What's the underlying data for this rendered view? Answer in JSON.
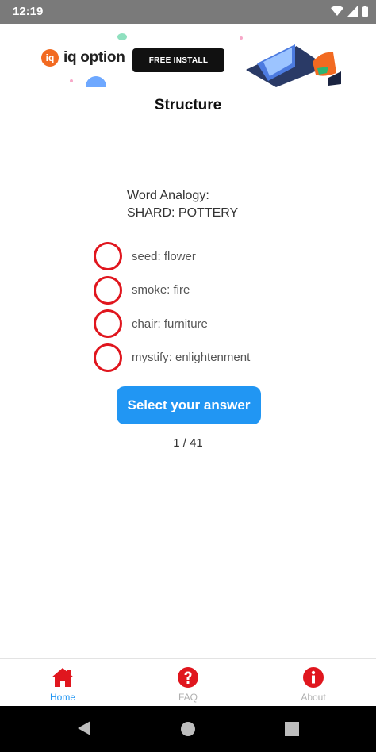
{
  "status_bar": {
    "time": "12:19"
  },
  "ad": {
    "brand": "iq option",
    "cta": "FREE INSTALL"
  },
  "page": {
    "title": "Structure"
  },
  "question": {
    "prompt": "Word Analogy:",
    "pair": "SHARD: POTTERY"
  },
  "options": [
    {
      "label": "seed: flower"
    },
    {
      "label": "smoke: fire"
    },
    {
      "label": "chair: furniture"
    },
    {
      "label": "mystify: enlightenment"
    }
  ],
  "submit": {
    "label": "Select your answer"
  },
  "progress": {
    "text": "1 / 41"
  },
  "bottom_nav": {
    "items": [
      {
        "label": "Home",
        "icon": "home-icon"
      },
      {
        "label": "FAQ",
        "icon": "question-circle-icon"
      },
      {
        "label": "About",
        "icon": "info-circle-icon"
      }
    ]
  },
  "colors": {
    "accent": "#2196f3",
    "radio": "#e0161e",
    "nav_icon": "#e0161e"
  }
}
